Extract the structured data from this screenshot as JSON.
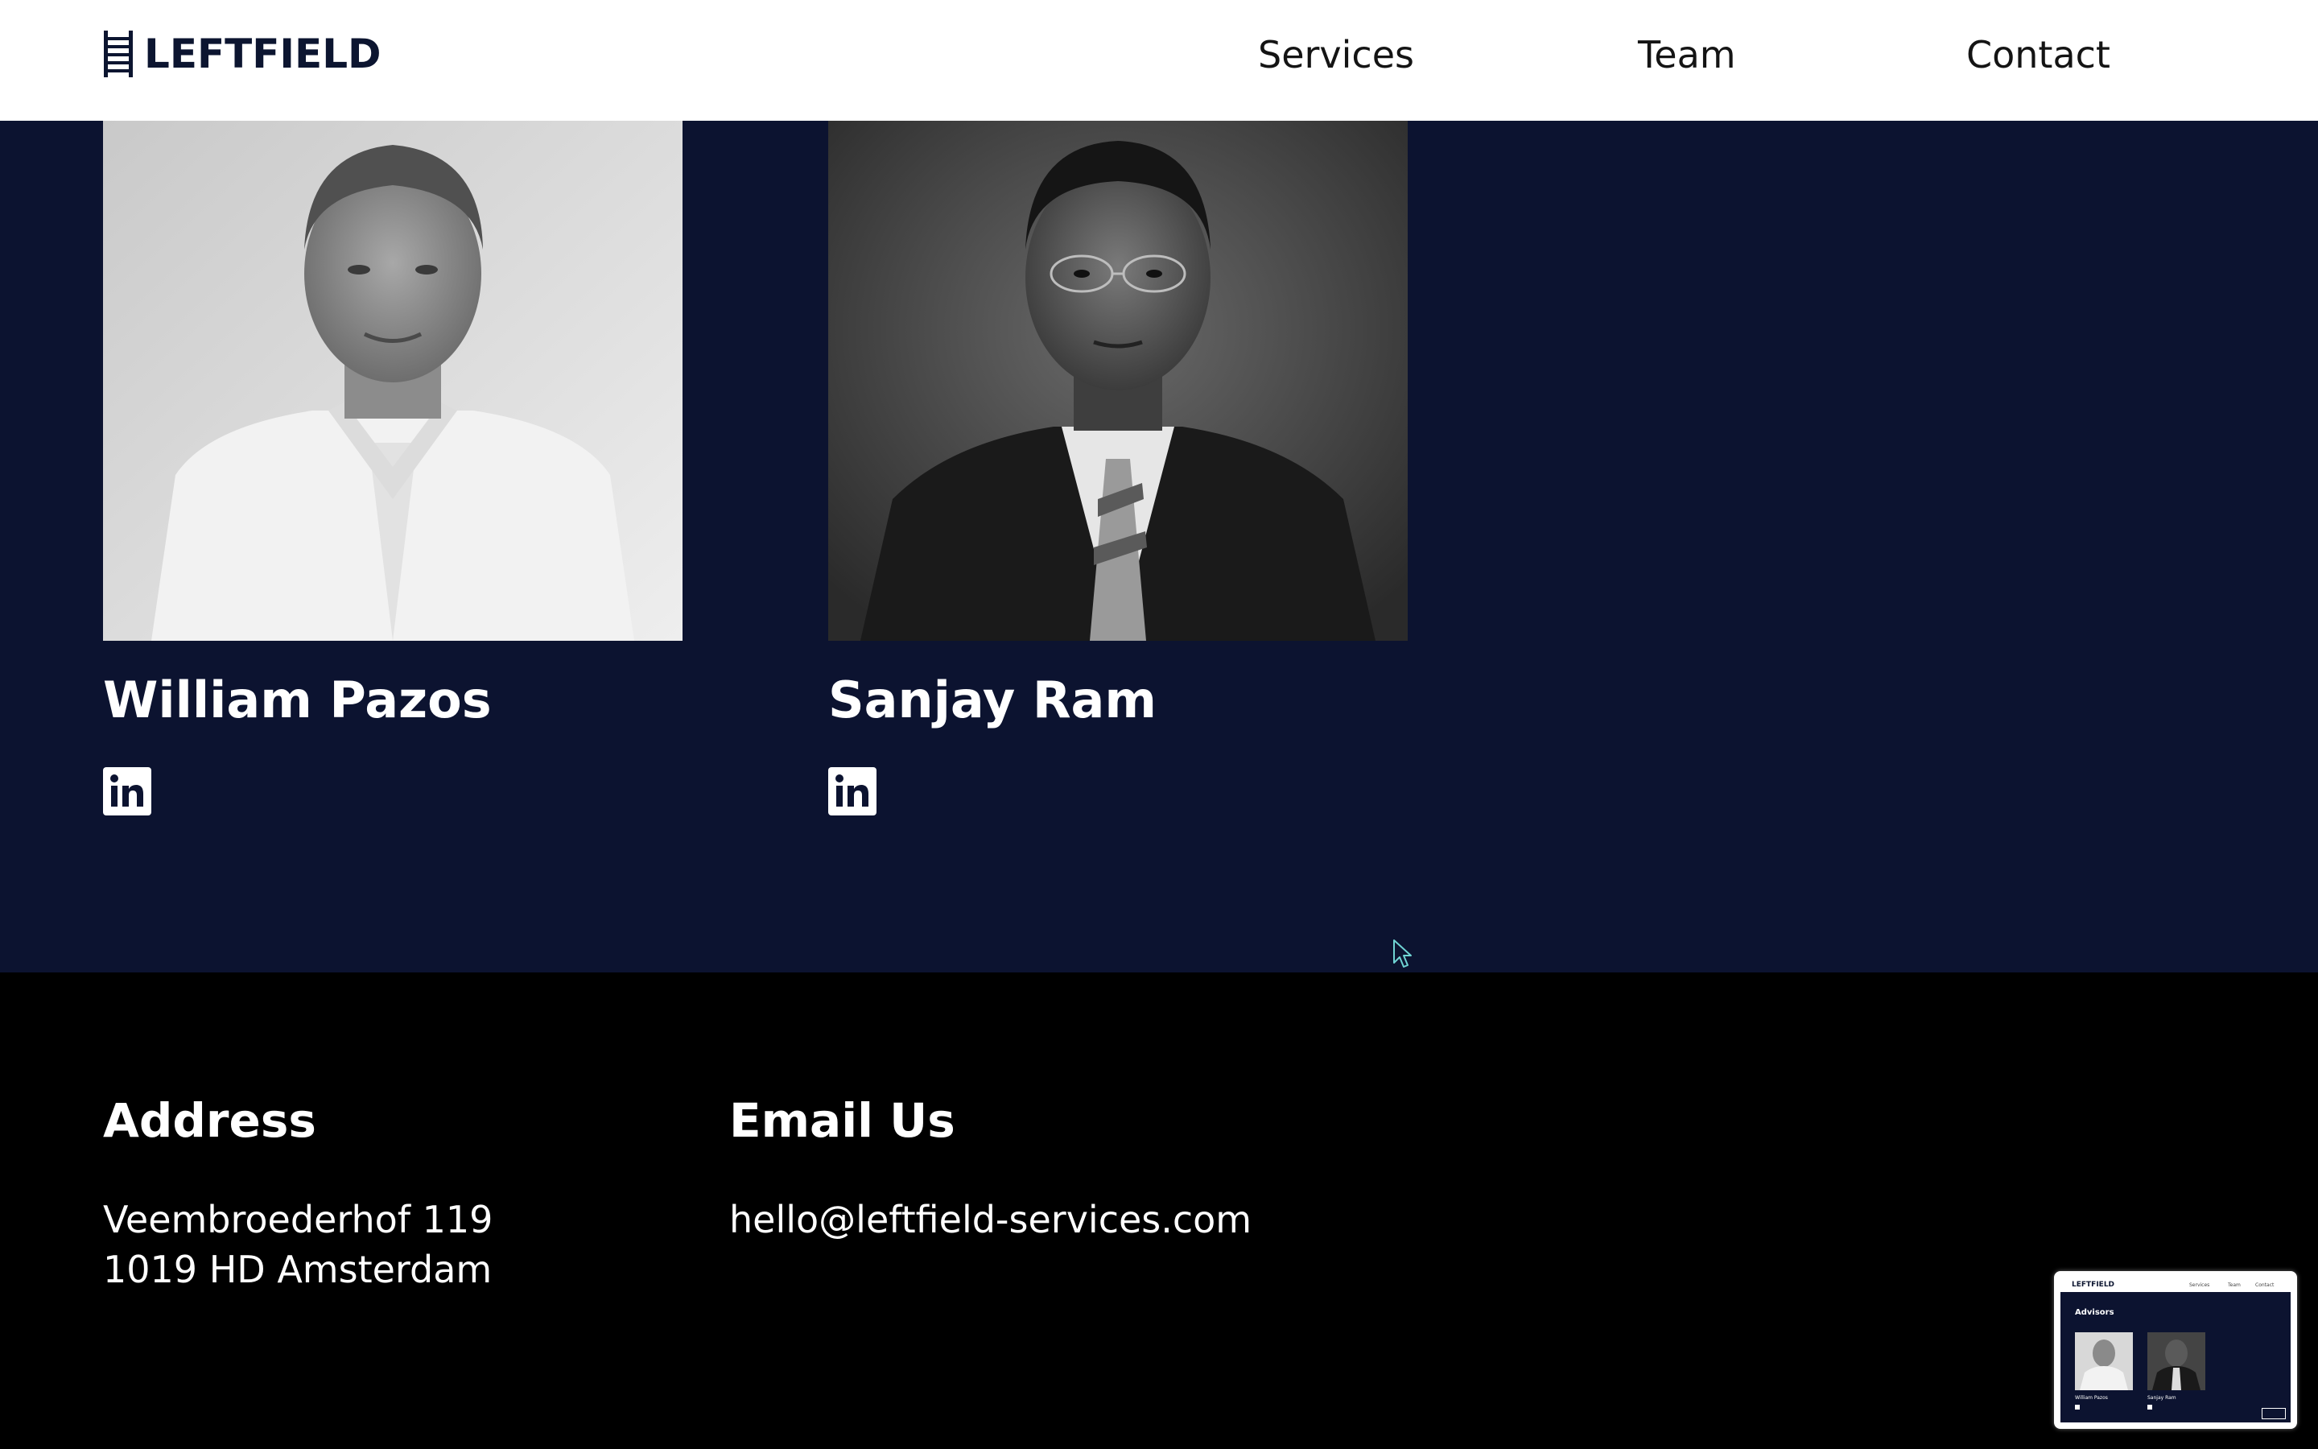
{
  "header": {
    "logo_text": "LEFTFIELD",
    "nav": {
      "services": "Services",
      "team": "Team",
      "contact": "Contact"
    }
  },
  "team": {
    "members": [
      {
        "name": "William Pazos",
        "social_icon": "linkedin-icon"
      },
      {
        "name": "Sanjay Ram",
        "social_icon": "linkedin-icon"
      }
    ]
  },
  "footer": {
    "address_heading": "Address",
    "address_line1": "Veembroederhof 119",
    "address_line2": "1019 HD Amsterdam",
    "email_heading": "Email Us",
    "email": "hello@leftfield-services.com"
  },
  "preview": {
    "logo_text": "LEFTFIELD",
    "nav": [
      "Services",
      "Team",
      "Contact"
    ],
    "section_title": "Advisors",
    "names": [
      "William Pazos",
      "Sanjay Ram"
    ]
  },
  "colors": {
    "navy": "#0c1330",
    "black": "#000000",
    "white": "#ffffff",
    "logo": "#0c1530",
    "cursor": "#6fd3d3"
  }
}
